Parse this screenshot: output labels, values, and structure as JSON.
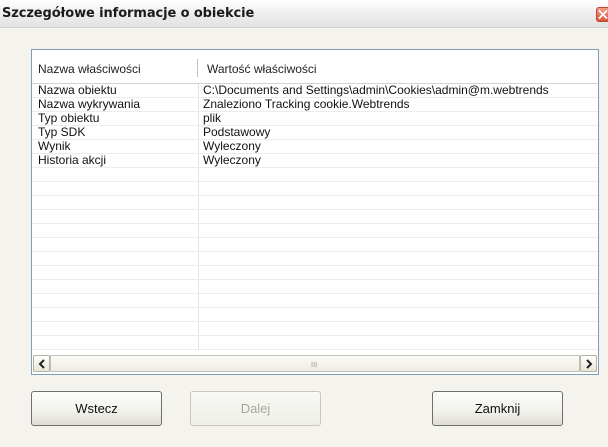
{
  "window": {
    "title": "Szczegółowe informacje o obiekcie"
  },
  "table": {
    "columns": [
      "Nazwa właściwości",
      "Wartość właściwości"
    ],
    "rows": [
      {
        "name": "Nazwa obiektu",
        "value": "C:\\Documents and Settings\\admin\\Cookies\\admin@m.webtrends"
      },
      {
        "name": "Nazwa wykrywania",
        "value": "Znaleziono Tracking cookie.Webtrends"
      },
      {
        "name": "Typ obiektu",
        "value": "plik"
      },
      {
        "name": "Typ SDK",
        "value": "Podstawowy"
      },
      {
        "name": "Wynik",
        "value": "Wyleczony"
      },
      {
        "name": "Historia akcji",
        "value": "Wyleczony"
      },
      {
        "name": "",
        "value": ""
      },
      {
        "name": "",
        "value": ""
      },
      {
        "name": "",
        "value": ""
      },
      {
        "name": "",
        "value": ""
      },
      {
        "name": "",
        "value": ""
      },
      {
        "name": "",
        "value": ""
      },
      {
        "name": "",
        "value": ""
      },
      {
        "name": "",
        "value": ""
      },
      {
        "name": "",
        "value": ""
      },
      {
        "name": "",
        "value": ""
      },
      {
        "name": "",
        "value": ""
      },
      {
        "name": "",
        "value": ""
      },
      {
        "name": "",
        "value": ""
      }
    ]
  },
  "buttons": {
    "back": "Wstecz",
    "next": "Dalej",
    "close": "Zamknij"
  },
  "icons": {
    "close": "close-icon",
    "scroll_left": "chevron-left-icon",
    "scroll_right": "chevron-right-icon",
    "grip": "scroll-grip-icon"
  },
  "scrollbar": {
    "grip": "III"
  },
  "colors": {
    "close_button": "#d9573c",
    "list_border": "#7f9db9"
  }
}
